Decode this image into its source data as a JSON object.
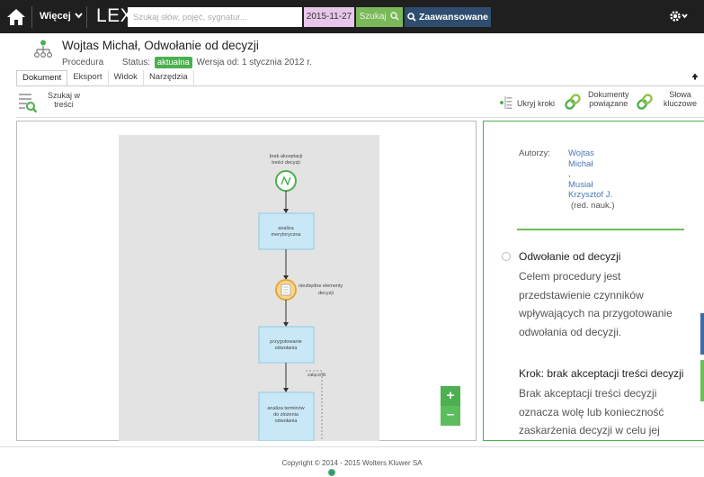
{
  "topbar": {
    "more_label": "Więcej",
    "logo_text": "LEX",
    "search_placeholder": "Szukaj słów, pojęć, sygnatur...",
    "date": "2015-11-27",
    "search_button": "Szukaj",
    "advanced_button": "Zaawansowane",
    "settings_icon": "gear-icon"
  },
  "document": {
    "title": "Wojtas Michał, Odwołanie od decyzji",
    "type": "Procedura",
    "status_label": "Status:",
    "status_value": "aktualna",
    "version": "Wersja od: 1 stycznia 2012 r."
  },
  "tabs": [
    "Dokument",
    "Eksport",
    "Widok",
    "Narzędzia"
  ],
  "toolbar": {
    "search_in_text_line1": "Szukaj w",
    "search_in_text_line2": "treści",
    "hide_steps": "Ukryj kroki",
    "related_docs_line1": "Dokumenty",
    "related_docs_line2": "powiązane",
    "keywords_line1": "Słowa",
    "keywords_line2": "kluczowe"
  },
  "diagram": {
    "start_line1": "brak akceptacji",
    "start_line2": "treści decyzji",
    "step1_line1": "analiza",
    "step1_line2": "merytoryczna",
    "gateway_line1": "niezbędne elementy",
    "gateway_line2": "decyzji",
    "step2_line1": "przygotowanie",
    "step2_line2": "odwołania",
    "attachment": "załącznik",
    "step3_line1": "analiza terminów",
    "step3_line2": "do złożenia",
    "step3_line3": "odwołania"
  },
  "zoom": {
    "in": "+",
    "out": "–"
  },
  "sidebar": {
    "authors_label": "Autorzy:",
    "author1_line1": "Wojtas",
    "author1_line2": "Michał",
    "separator": ",",
    "author2_line1": "Musiał",
    "author2_line2": "Krzysztof J.",
    "author2_role": "(red. nauk.)",
    "section_title": "Odwołanie od decyzji",
    "section_body": "Celem procedury jest przedstawienie czynników wpływających na przygotowanie odwołania od decyzji.",
    "step_title": "Krok: brak akceptacji treści decyzji",
    "step_body": "Brak akceptacji treści decyzji oznacza wolę lub konieczność zaskarżenia decyzji w celu jej"
  },
  "footer": {
    "copyright": "Copyright © 2014 - 2015 Wolters Kluwer SA"
  },
  "colors": {
    "topbar": "#1f1f1f",
    "date_bg": "#e8c6eb",
    "search_btn": "#7ab85a",
    "advanced_btn": "#2f4d6e",
    "status_green": "#4caf50",
    "link_blue": "#4a78b5"
  }
}
